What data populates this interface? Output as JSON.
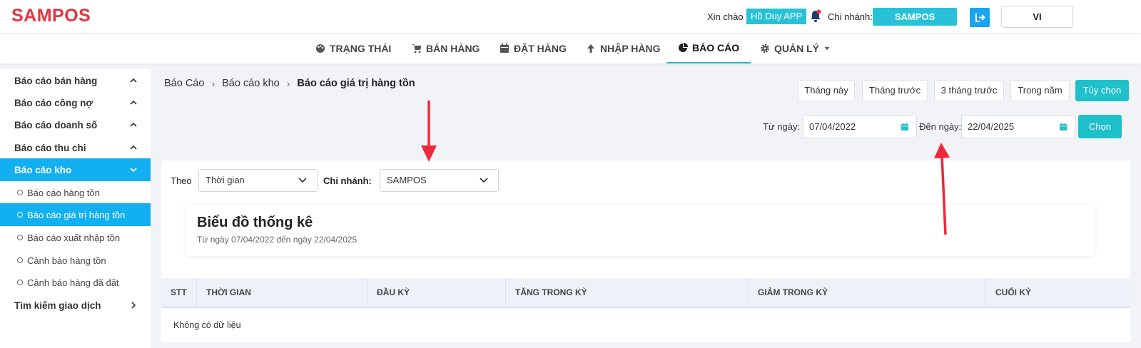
{
  "header": {
    "logo": "SAMPOS",
    "greeting": "Xin chào",
    "user_name": "Hồ Duy APP",
    "branch_label": "Chi nhánh:",
    "branch_value": "SAMPOS",
    "language": "VI"
  },
  "nav": {
    "items": [
      {
        "label": "TRẠNG THÁI",
        "icon": "palette-icon"
      },
      {
        "label": "BÁN HÀNG",
        "icon": "cart-icon"
      },
      {
        "label": "ĐẶT HÀNG",
        "icon": "calendar-icon"
      },
      {
        "label": "NHẬP HÀNG",
        "icon": "arrow-up-icon"
      },
      {
        "label": "BÁO CÁO",
        "icon": "pie-chart-icon",
        "active": true
      },
      {
        "label": "QUẢN LÝ",
        "icon": "gear-icon"
      }
    ]
  },
  "sidebar": {
    "groups": [
      {
        "label": "Báo cáo bán hàng"
      },
      {
        "label": "Báo cáo công nợ"
      },
      {
        "label": "Báo cáo doanh số"
      },
      {
        "label": "Báo cáo thu chi"
      },
      {
        "label": "Báo cáo kho",
        "active": true
      }
    ],
    "sub_items": [
      {
        "label": "Báo cáo hàng tồn"
      },
      {
        "label": "Báo cáo giá trị hàng tồn",
        "active": true
      },
      {
        "label": "Báo cáo xuất nhập tồn"
      },
      {
        "label": "Cảnh báo hàng tồn"
      },
      {
        "label": "Cảnh báo hàng đã đặt"
      }
    ],
    "last_group": "Tìm kiếm giao dịch"
  },
  "breadcrumb": {
    "items": [
      "Báo Cáo",
      "Báo cáo kho"
    ],
    "current": "Báo cáo giá trị hàng tồn"
  },
  "range_buttons": [
    "Tháng này",
    "Tháng trước",
    "3 tháng trước",
    "Trong năm",
    "Tùy chọn"
  ],
  "date_filter": {
    "from_label": "Từ ngày:",
    "from_value": "07/04/2022",
    "to_label": "Đến ngày:",
    "to_value": "22/04/2025",
    "submit": "Chọn"
  },
  "filters": {
    "by_label": "Theo",
    "by_value": "Thời gian",
    "branch_label": "Chi nhánh:",
    "branch_value": "SAMPOS"
  },
  "chart": {
    "title": "Biểu đồ thống kê",
    "subtitle": "Từ ngày 07/04/2022 đến ngày 22/04/2025"
  },
  "table": {
    "headers": [
      "STT",
      "THỜI GIAN",
      "ĐẦU KỲ",
      "TĂNG TRONG KỲ",
      "GIẢM TRONG KỲ",
      "CUỐI KỲ"
    ],
    "empty_text": "Không có dữ liệu"
  },
  "colors": {
    "brand": "#e8323e",
    "accent": "#1ec0c9",
    "sidebar_active": "#12b0f0",
    "annotation_arrow": "#f0283c"
  }
}
